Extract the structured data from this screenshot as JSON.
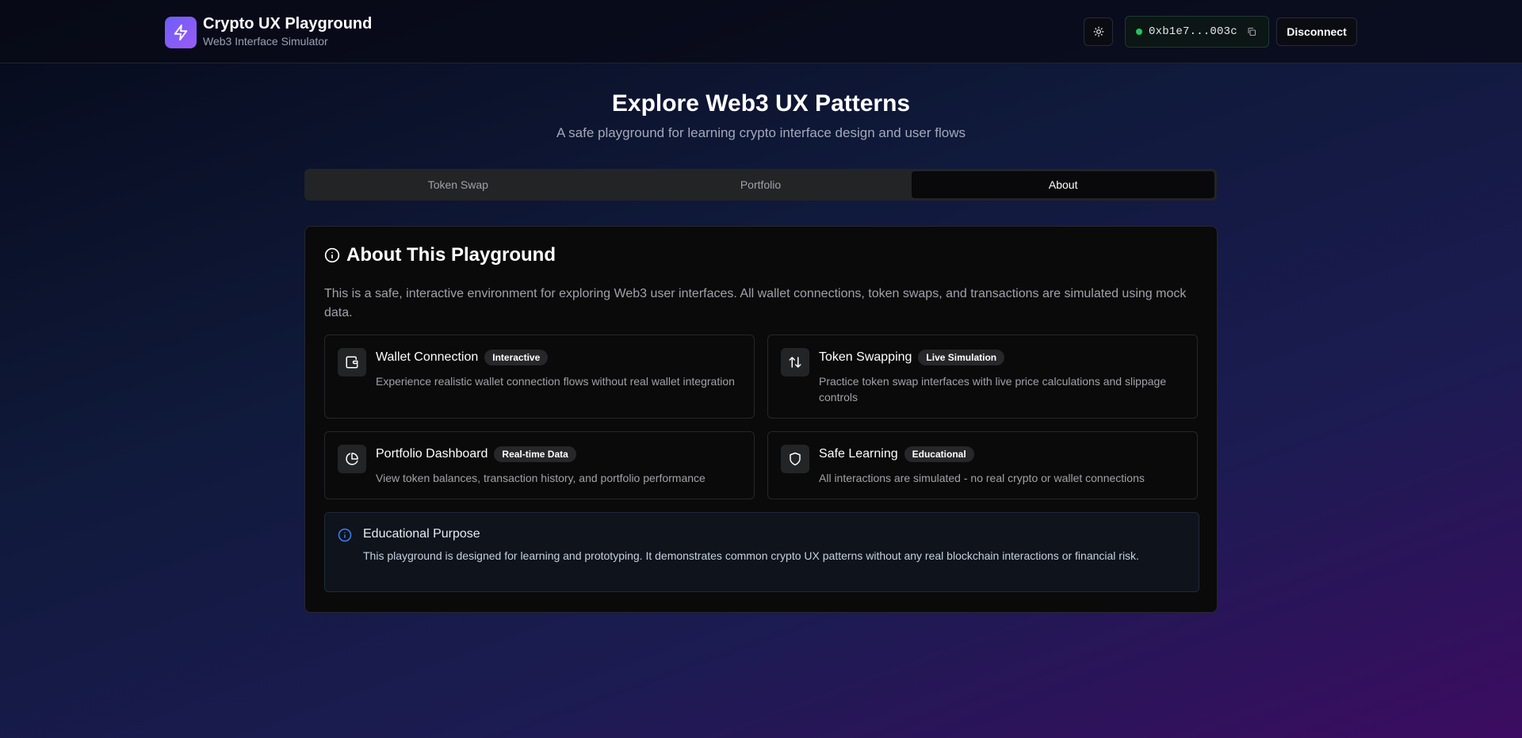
{
  "header": {
    "app_title": "Crypto UX Playground",
    "app_subtitle": "Web3 Interface Simulator",
    "logo_icon": "lightning-bolt-icon",
    "theme_toggle_icon": "sun-icon",
    "wallet": {
      "status_color": "#22c55e",
      "address": "0xb1e7...003c",
      "copy_icon": "copy-icon"
    },
    "disconnect_label": "Disconnect"
  },
  "hero": {
    "title": "Explore Web3 UX Patterns",
    "subtitle": "A safe playground for learning crypto interface design and user flows"
  },
  "tabs": [
    {
      "label": "Token Swap",
      "active": false
    },
    {
      "label": "Portfolio",
      "active": false
    },
    {
      "label": "About",
      "active": true
    }
  ],
  "about": {
    "title": "About This Playground",
    "title_icon": "info-icon",
    "description": "This is a safe, interactive environment for exploring Web3 user interfaces. All wallet connections, token swaps, and transactions are simulated using mock data.",
    "features": [
      {
        "icon": "wallet-icon",
        "title": "Wallet Connection",
        "badge": "Interactive",
        "description": "Experience realistic wallet connection flows without real wallet integration"
      },
      {
        "icon": "swap-arrows-icon",
        "title": "Token Swapping",
        "badge": "Live Simulation",
        "description": "Practice token swap interfaces with live price calculations and slippage controls"
      },
      {
        "icon": "pie-chart-icon",
        "title": "Portfolio Dashboard",
        "badge": "Real-time Data",
        "description": "View token balances, transaction history, and portfolio performance"
      },
      {
        "icon": "shield-icon",
        "title": "Safe Learning",
        "badge": "Educational",
        "description": "All interactions are simulated - no real crypto or wallet connections"
      }
    ],
    "notice": {
      "icon": "info-icon",
      "title": "Educational Purpose",
      "description": "This playground is designed for learning and prototyping. It demonstrates common crypto UX patterns without any real blockchain interactions or financial risk.",
      "accent_color": "#3b82f6"
    }
  }
}
